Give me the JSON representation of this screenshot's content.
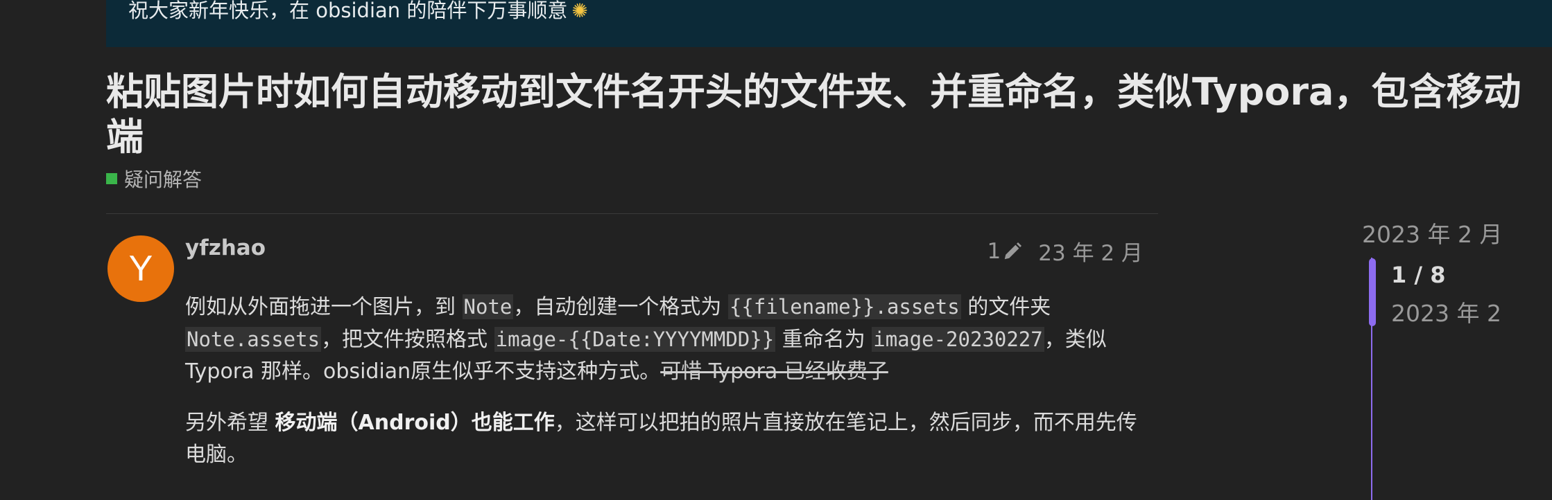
{
  "banner": {
    "text": "祝大家新年快乐，在 obsidian 的陪伴下万事顺意",
    "icon": "sparkler-icon"
  },
  "topic": {
    "title": "粘贴图片时如何自动移动到文件名开头的文件夹、并重命名，类似Typora，包含移动端",
    "category": {
      "label": "疑问解答",
      "color": "#3ab54a"
    }
  },
  "post": {
    "avatar_letter": "Y",
    "avatar_color": "#e8720c",
    "username": "yfzhao",
    "edit_count": "1",
    "date": "23 年 2 月",
    "p1": {
      "t1": "例如从外面拖进一个图片，到 ",
      "c1": "Note",
      "t2": "，自动创建一个格式为 ",
      "c2": "{{filename}}.assets",
      "t3": " 的文件夹 ",
      "c3": "Note.assets",
      "t4": "，把文件按照格式 ",
      "c4": "image-{{Date:YYYYMMDD}}",
      "t5": " 重命名为 ",
      "c5": "image-20230227",
      "t6": "，类似 Typora 那样。obsidian原生似乎不支持这种方式。",
      "strike": "可惜 Typora 已经收费了"
    },
    "p2": {
      "t1": "另外希望 ",
      "bold": "移动端（Android）也能工作",
      "t2": "，这样可以把拍的照片直接放在笔记上，然后同步，而不用先传电脑。"
    }
  },
  "timeline": {
    "top_date": "2023 年 2 月",
    "position": "1 / 8",
    "current_date": "2023 年 2",
    "accent": "#8d6cf0"
  }
}
